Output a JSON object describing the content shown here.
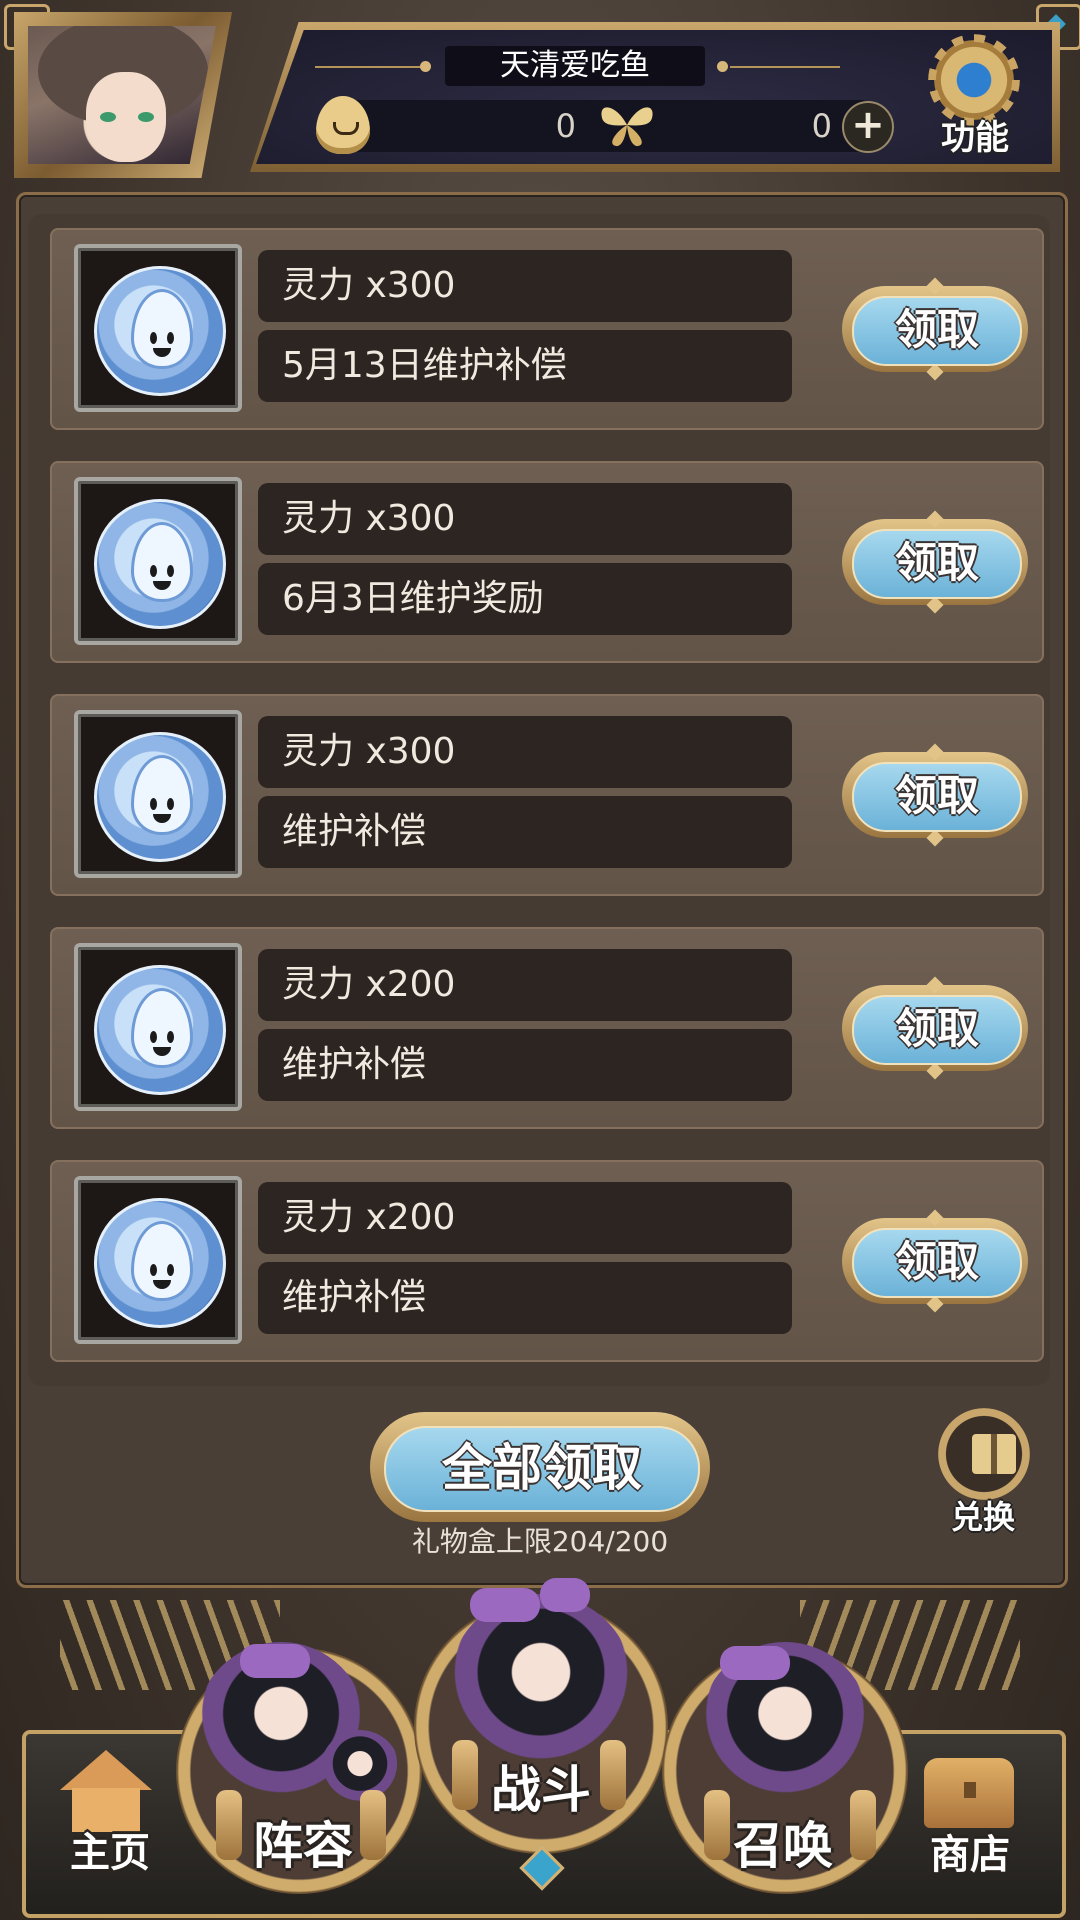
{
  "header": {
    "player_name": "天清爱吃鱼",
    "currency_a_value": "0",
    "currency_b_value": "0",
    "function_label": "功能"
  },
  "rewards": [
    {
      "title": "灵力 x300",
      "desc": "5月13日维护补偿",
      "button": "领取"
    },
    {
      "title": "灵力 x300",
      "desc": "6月3日维护奖励",
      "button": "领取"
    },
    {
      "title": "灵力 x300",
      "desc": "维护补偿",
      "button": "领取"
    },
    {
      "title": "灵力 x200",
      "desc": "维护补偿",
      "button": "领取"
    },
    {
      "title": "灵力 x200",
      "desc": "维护补偿",
      "button": "领取"
    }
  ],
  "actions": {
    "claim_all": "全部领取",
    "exchange": "兑换",
    "limit_text": "礼物盒上限204/200"
  },
  "nav": {
    "home": "主页",
    "lineup": "阵容",
    "battle": "战斗",
    "summon": "召唤",
    "shop": "商店"
  },
  "colors": {
    "button_blue": "#6bb2d8",
    "frame_gold": "#c9a66b",
    "panel_brown": "#4a3f37"
  },
  "icons": {
    "reward_item": "spirit-coin-icon",
    "currency_a": "flame-spirit-icon",
    "currency_b": "butterfly-icon",
    "add": "plus-icon",
    "function": "gear-icon",
    "exchange": "gift-box-icon",
    "home": "house-icon",
    "shop": "treasure-chest-icon"
  }
}
